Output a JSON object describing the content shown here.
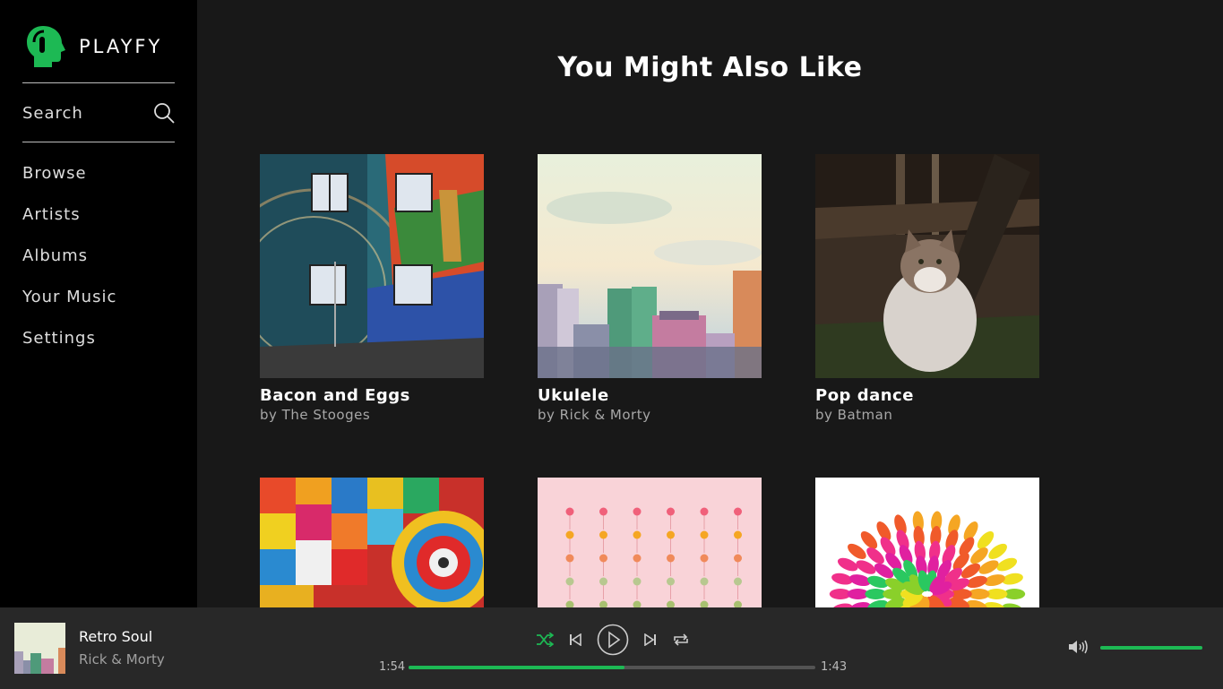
{
  "app": {
    "name": "PLAYFY"
  },
  "colors": {
    "accent": "#1db954",
    "sidebar_bg": "#000000",
    "main_bg": "#181818",
    "player_bg": "#282828"
  },
  "sidebar": {
    "search_label": "Search",
    "items": [
      {
        "label": "Browse"
      },
      {
        "label": "Artists"
      },
      {
        "label": "Albums"
      },
      {
        "label": "Your Music"
      },
      {
        "label": "Settings"
      }
    ]
  },
  "main": {
    "title": "You Might Also Like",
    "cards": [
      {
        "title": "Bacon and Eggs",
        "artist": "by The Stooges"
      },
      {
        "title": "Ukulele",
        "artist": "by Rick & Morty"
      },
      {
        "title": "Pop dance",
        "artist": "by Batman"
      },
      {
        "title": "",
        "artist": ""
      },
      {
        "title": "",
        "artist": ""
      },
      {
        "title": "",
        "artist": ""
      }
    ]
  },
  "player": {
    "track_title": "Retro Soul",
    "track_artist": "Rick & Morty",
    "elapsed": "1:54",
    "remaining": "1:43",
    "progress_fraction": 0.53,
    "volume_fraction": 1.0,
    "icons": [
      "shuffle-icon",
      "previous-icon",
      "play-icon",
      "next-icon",
      "repeat-icon",
      "volume-icon"
    ]
  }
}
